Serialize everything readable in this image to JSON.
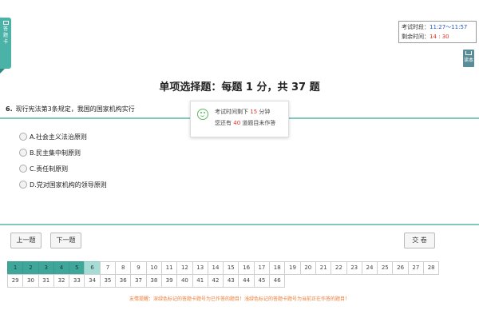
{
  "side_tab": {
    "label": "答题卡"
  },
  "timer": {
    "period_label": "考试时段：",
    "period_value": "11:27～11:57",
    "remaining_label": "剩余时间：",
    "remaining_value": "14 : 30"
  },
  "read_button": {
    "label": "读本"
  },
  "section_title": "单项选择题：每题 1 分，共 37 题",
  "question": {
    "number": "6.",
    "text": "现行宪法第3条规定，我国的国家机构实行",
    "options": [
      "A.社会主义法治原则",
      "B.民主集中制原则",
      "C.责任制原则",
      "D.党对国家机构的领导原则"
    ]
  },
  "popup": {
    "line1_prefix": "考试时间剩下",
    "line1_num": "15",
    "line1_suffix": "分钟",
    "line2_prefix": "您还有",
    "line2_num": "40",
    "line2_suffix": "道题目未作答"
  },
  "nav": {
    "prev_label": "上一题",
    "next_label": "下一题",
    "submit_label": "交  卷"
  },
  "question_grid": {
    "row1": [
      "1",
      "2",
      "3",
      "4",
      "5",
      "6",
      "7",
      "8",
      "9",
      "10",
      "11",
      "12",
      "13",
      "14",
      "15",
      "16",
      "17",
      "18",
      "19",
      "20",
      "21",
      "22",
      "23",
      "24",
      "25",
      "26",
      "27",
      "28"
    ],
    "row2": [
      "29",
      "30",
      "31",
      "32",
      "33",
      "34",
      "35",
      "36",
      "37",
      "38",
      "39",
      "40",
      "41",
      "42",
      "43",
      "44",
      "45",
      "46"
    ],
    "answered": [
      "1",
      "2",
      "3",
      "4",
      "5"
    ],
    "current": "6"
  },
  "hint": "友情提醒：深绿色标记的答题卡题号为已作答的题目！浅绿色标记的答题卡题号为当前正在作答的题目！",
  "colors": {
    "accent": "#4ab2a6",
    "answered": "#3fa69a",
    "current": "#a5dcd5",
    "warning": "#e4322a",
    "hint": "#ee7b33"
  }
}
